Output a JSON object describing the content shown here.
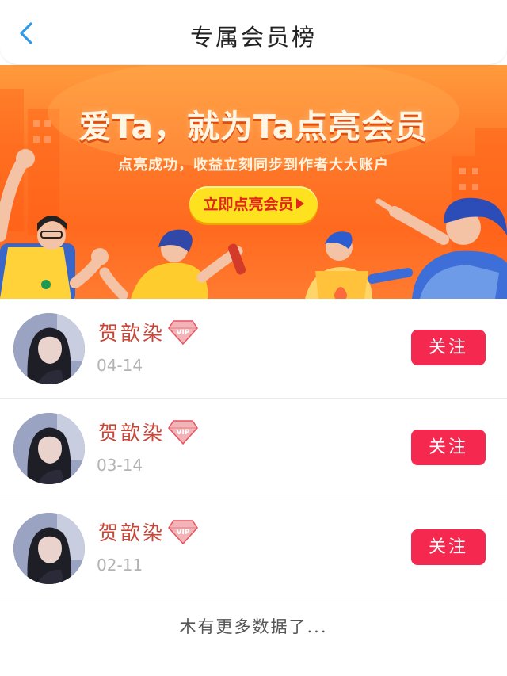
{
  "header": {
    "title": "专属会员榜",
    "back_icon": "chevron-left-icon",
    "accent_color": "#2f9be8"
  },
  "banner": {
    "headline": "爱Ta，就为Ta点亮会员",
    "subtitle": "点亮成功，收益立刻同步到作者大大账户",
    "cta_label": "立即点亮会员",
    "cta_icon": "play-triangle-icon",
    "background_color": "#ff7a2a",
    "cta_color": "#ffe21f"
  },
  "members": [
    {
      "name": "贺歆染",
      "badge": "VIP",
      "date": "04-14",
      "follow_label": "关注"
    },
    {
      "name": "贺歆染",
      "badge": "VIP",
      "date": "03-14",
      "follow_label": "关注"
    },
    {
      "name": "贺歆染",
      "badge": "VIP",
      "date": "02-11",
      "follow_label": "关注"
    }
  ],
  "footer": {
    "no_more_text": "木有更多数据了..."
  },
  "colors": {
    "name_color": "#c4473a",
    "follow_button": "#f5294f",
    "date_color": "#b3b3b3"
  }
}
